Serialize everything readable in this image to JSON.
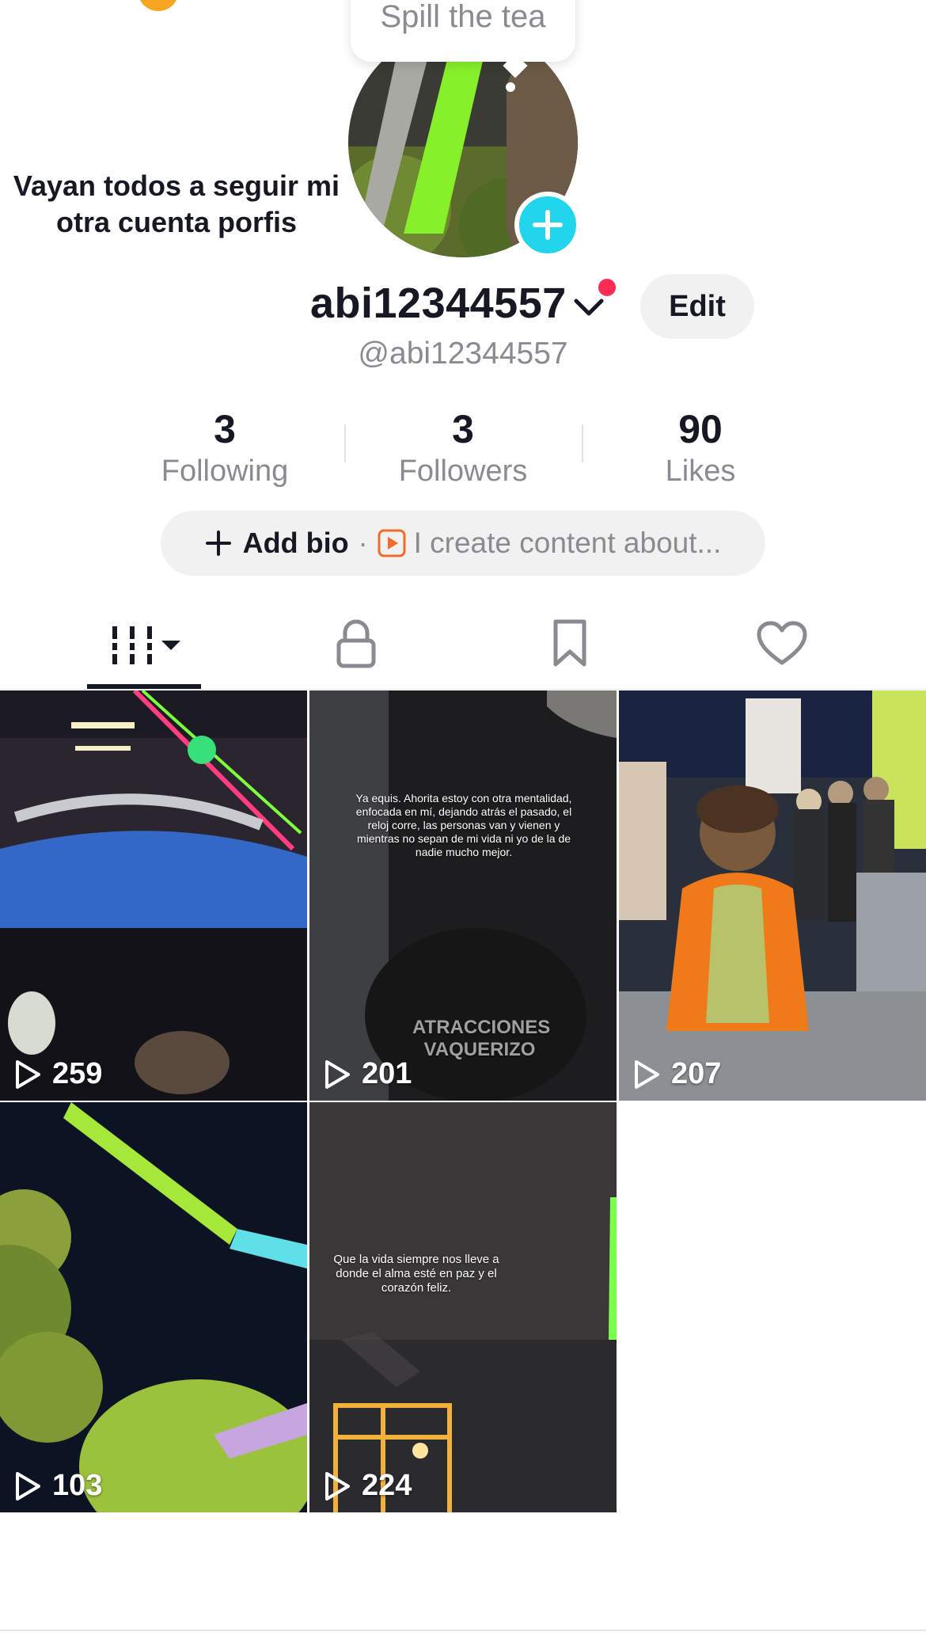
{
  "tooltip": {
    "text": "Spill the tea"
  },
  "note": {
    "text": "Vayan todos a seguir mi otra cuenta porfis"
  },
  "profile": {
    "display_name": "abi12344557",
    "handle": "@abi12344557",
    "edit_label": "Edit"
  },
  "stats": [
    {
      "value": "3",
      "label": "Following"
    },
    {
      "value": "3",
      "label": "Followers"
    },
    {
      "value": "90",
      "label": "Likes"
    }
  ],
  "bio": {
    "add_label": "Add bio",
    "separator": "·",
    "hint": "I create content about..."
  },
  "tabs": [
    {
      "icon": "videos-grid-icon",
      "active": true
    },
    {
      "icon": "lock-icon",
      "active": false
    },
    {
      "icon": "bookmark-icon",
      "active": false
    },
    {
      "icon": "heart-icon",
      "active": false
    }
  ],
  "videos": [
    {
      "views": "259"
    },
    {
      "views": "201",
      "caption": "Ya equis. Ahorita estoy con otra mentalidad, enfocada en mí, dejando atrás el pasado, el reloj corre, las personas van y vienen y mientras no sepan de mi vida ni yo de la de nadie mucho mejor.",
      "overlay": "ATRACCIONES VAQUERIZO"
    },
    {
      "views": "207"
    },
    {
      "views": "103"
    },
    {
      "views": "224",
      "caption": "Que la vida siempre nos lleve a donde el alma esté en paz y el corazón feliz."
    }
  ],
  "colors": {
    "accent_plus": "#20d5ec",
    "notification": "#fe2c55",
    "text_primary": "#161823",
    "text_secondary": "#8a8b91"
  }
}
